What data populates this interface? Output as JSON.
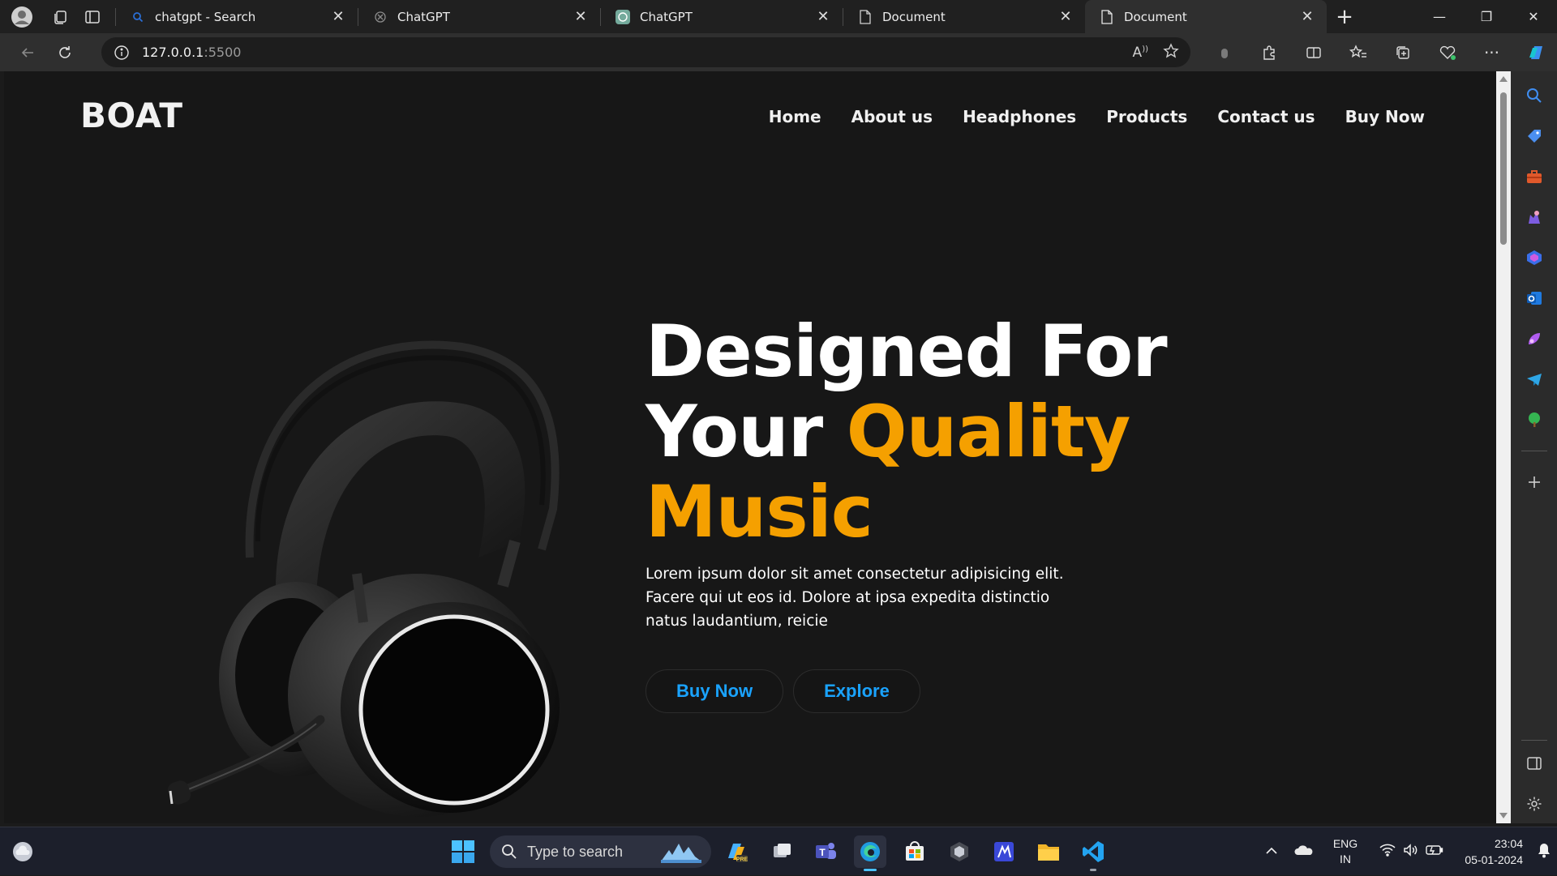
{
  "browser": {
    "tabs": [
      {
        "title": "chatgpt - Search",
        "icon": "search-icon",
        "active": false
      },
      {
        "title": "ChatGPT",
        "icon": "openai-icon",
        "active": false
      },
      {
        "title": "ChatGPT",
        "icon": "openai-icon",
        "active": false
      },
      {
        "title": "Document",
        "icon": "document-icon",
        "active": false
      },
      {
        "title": "Document",
        "icon": "document-icon",
        "active": true
      }
    ],
    "address": {
      "host": "127.0.0.1",
      "port": ":5500"
    }
  },
  "site": {
    "brand": "BOAT",
    "nav": [
      "Home",
      "About us",
      "Headphones",
      "Products",
      "Contact us",
      "Buy Now"
    ],
    "hero": {
      "title_line1": "Designed For",
      "title_line2_a": "Your",
      "title_line2_b": "Quality",
      "title_line3": "Music",
      "text_line1": "Lorem ipsum dolor sit amet consectetur adipisicing elit.",
      "text_line2": "Facere qui ut eos id. Dolore at ipsa expedita distinctio",
      "text_line3": "natus laudantium, reicie",
      "btn_primary": "Buy Now",
      "btn_secondary": "Explore"
    },
    "colors": {
      "accent": "#f5a000",
      "button_text": "#1aa3ff",
      "background": "#171717"
    }
  },
  "taskbar": {
    "search_placeholder": "Type to search",
    "lang_line1": "ENG",
    "lang_line2": "IN",
    "time": "23:04",
    "date": "05-01-2024"
  }
}
